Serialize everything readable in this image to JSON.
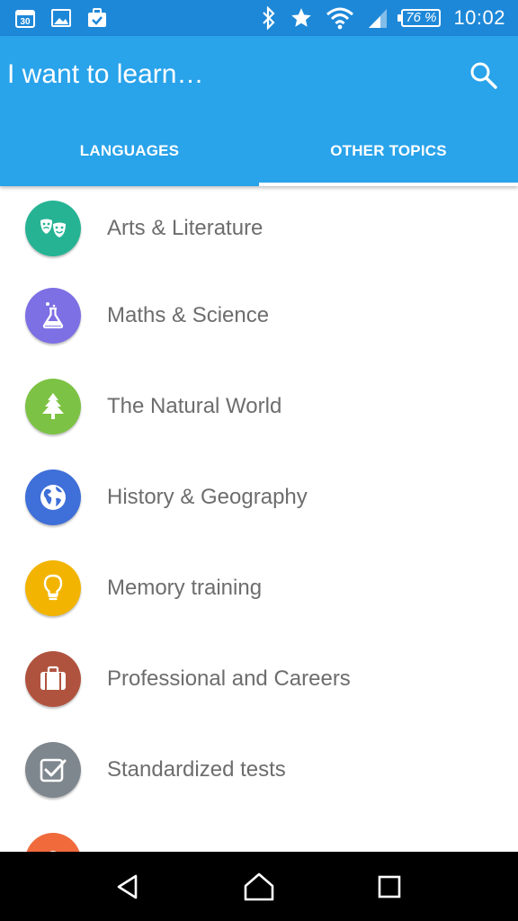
{
  "status_bar": {
    "calendar_day": "30",
    "battery_percent": "76 %",
    "time": "10:02"
  },
  "app_bar": {
    "title": "I want to learn…",
    "tabs": [
      {
        "label": "LANGUAGES",
        "active": false
      },
      {
        "label": "OTHER TOPICS",
        "active": true
      }
    ]
  },
  "topics": [
    {
      "label": "Arts & Literature",
      "icon": "theater-masks-icon",
      "color": "#26b394"
    },
    {
      "label": "Maths & Science",
      "icon": "flask-icon",
      "color": "#7d6fe4"
    },
    {
      "label": "The Natural World",
      "icon": "tree-icon",
      "color": "#7cc244"
    },
    {
      "label": "History & Geography",
      "icon": "globe-icon",
      "color": "#3f6fd8"
    },
    {
      "label": "Memory training",
      "icon": "lightbulb-icon",
      "color": "#f2b400"
    },
    {
      "label": "Professional and Careers",
      "icon": "briefcase-icon",
      "color": "#b0533e"
    },
    {
      "label": "Standardized tests",
      "icon": "checkbox-icon",
      "color": "#7f878e"
    },
    {
      "label": "",
      "icon": "partial-icon",
      "color": "#f06a3c"
    }
  ],
  "colors": {
    "status_bar": "#1e88d8",
    "app_bar": "#29a3ea",
    "nav_bar": "#000000"
  }
}
